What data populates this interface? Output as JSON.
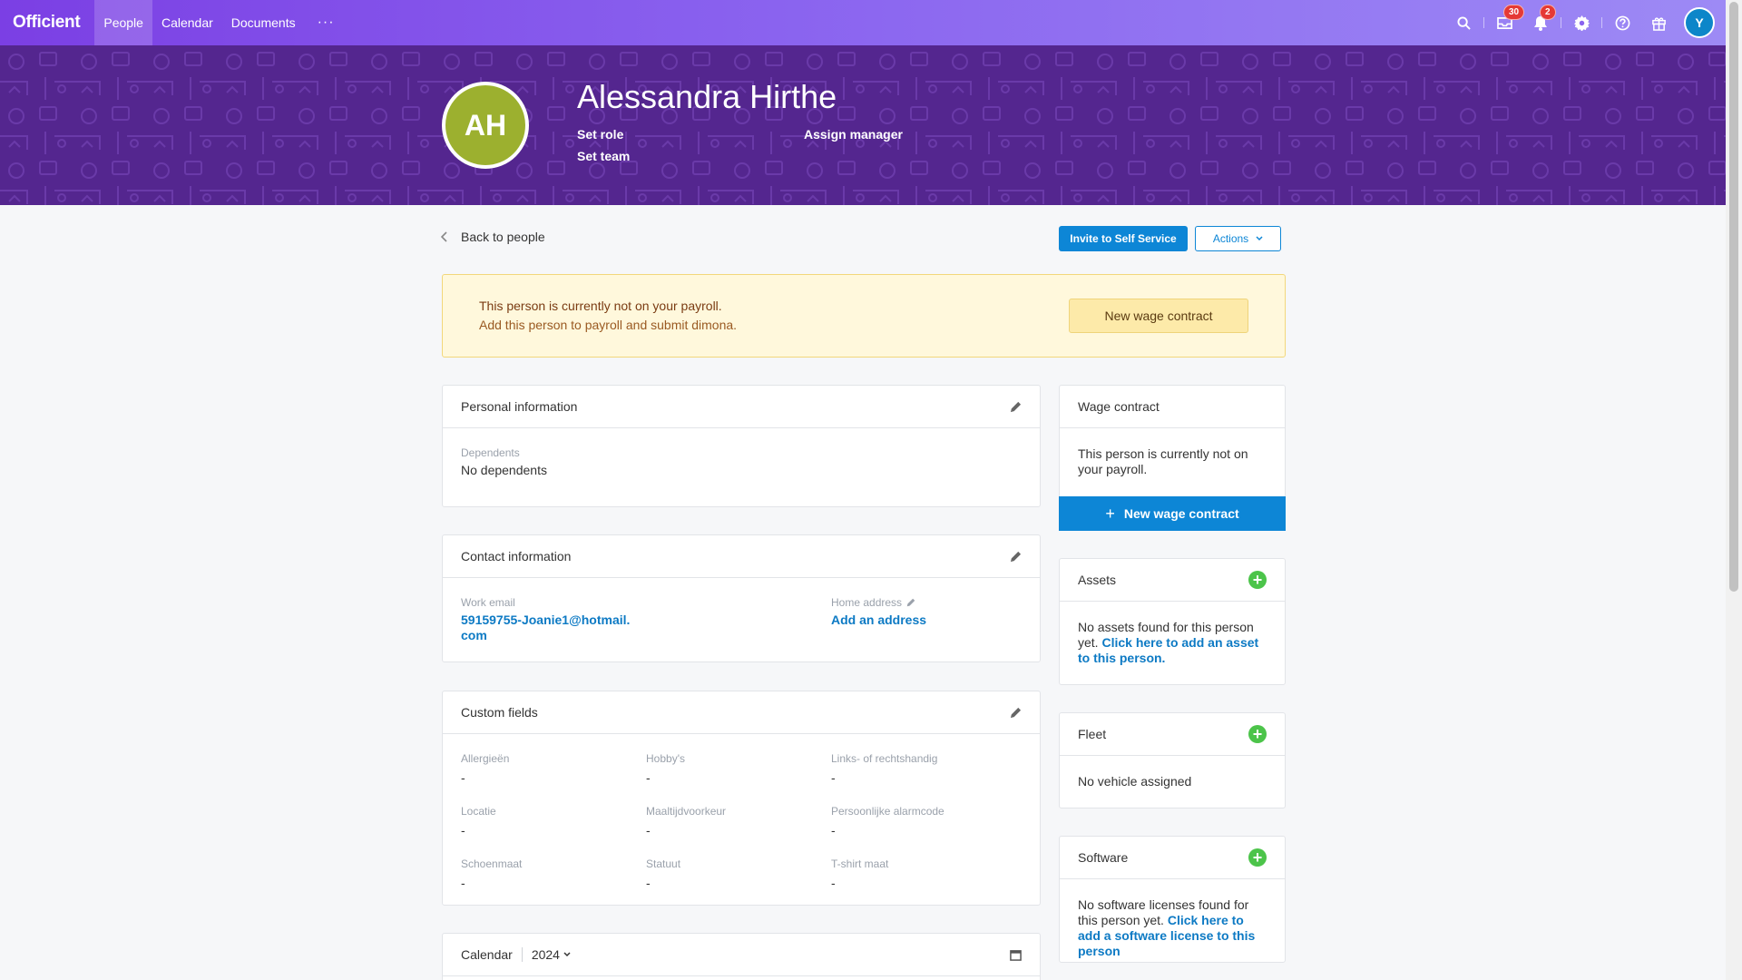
{
  "app": {
    "logo": "Officient"
  },
  "nav": {
    "items": [
      "People",
      "Calendar",
      "Documents"
    ],
    "more": "···"
  },
  "topbar": {
    "inbox_count": "30",
    "notif_count": "2",
    "user_initial": "Y"
  },
  "profile": {
    "initials": "AH",
    "name": "Alessandra Hirthe",
    "set_role": "Set role",
    "assign_manager": "Assign manager",
    "set_team": "Set team"
  },
  "actions": {
    "back": "Back to people",
    "invite": "Invite to Self Service",
    "actions": "Actions"
  },
  "alert": {
    "title": "This person is currently not on your payroll.",
    "subtitle": "Add this person to payroll and submit dimona.",
    "button": "New wage contract"
  },
  "personal": {
    "title": "Personal information",
    "dependents_label": "Dependents",
    "dependents_value": "No dependents"
  },
  "contact": {
    "title": "Contact information",
    "work_email_label": "Work email",
    "work_email_line1": "59159755-Joanie1@hotmail.",
    "work_email_line2": "com",
    "home_address_label": "Home address",
    "home_address_value": "Add an address"
  },
  "custom": {
    "title": "Custom fields",
    "fields": [
      {
        "label": "Allergieën",
        "value": "-"
      },
      {
        "label": "Hobby's",
        "value": "-"
      },
      {
        "label": "Links- of rechtshandig",
        "value": "-"
      },
      {
        "label": "Locatie",
        "value": "-"
      },
      {
        "label": "Maaltijdvoorkeur",
        "value": "-"
      },
      {
        "label": "Persoonlijke alarmcode",
        "value": "-"
      },
      {
        "label": "Schoenmaat",
        "value": "-"
      },
      {
        "label": "Statuut",
        "value": "-"
      },
      {
        "label": "T-shirt maat",
        "value": "-"
      }
    ]
  },
  "calendar": {
    "title": "Calendar",
    "year": "2024"
  },
  "wage": {
    "title": "Wage contract",
    "body": "This person is currently not on your payroll.",
    "button": "New wage contract"
  },
  "assets": {
    "title": "Assets",
    "body": "No assets found for this person yet.",
    "link": "Click here to add an asset to this person."
  },
  "fleet": {
    "title": "Fleet",
    "body": "No vehicle assigned"
  },
  "software": {
    "title": "Software",
    "body": "No software licenses found for this person yet.",
    "link": "Click here to add a software license to this person"
  }
}
